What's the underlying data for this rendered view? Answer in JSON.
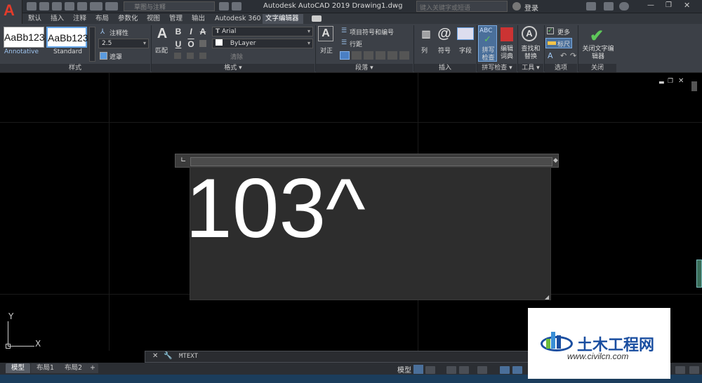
{
  "titlebar": {
    "logo": "A",
    "workspace_placeholder": "草图与注释",
    "title": "Autodesk AutoCAD 2019    Drawing1.dwg",
    "search_placeholder": "键入关键字或短语",
    "login_label": "登录"
  },
  "ribbon_tabs": [
    "默认",
    "插入",
    "注释",
    "布局",
    "参数化",
    "视图",
    "管理",
    "输出",
    "Autodesk 360",
    "文字编辑器"
  ],
  "active_tab": "文字编辑器",
  "style_panel": {
    "style_a": "AaBb123",
    "style_a_name": "Annotative",
    "style_b": "AaBb123",
    "style_b_name": "Standard",
    "annotative_label": "注释性",
    "text_height": "2.5",
    "mask_label": "遮罩",
    "label": "样式"
  },
  "format_panel": {
    "match_label": "匹配",
    "bold": "B",
    "italic": "I",
    "underline": "U",
    "overline": "O",
    "strike": "A",
    "font": "Arial",
    "color": "ByLayer",
    "clear_label": "清除",
    "label": "格式 ▾"
  },
  "paragraph_panel": {
    "justify_label": "对正",
    "bullets_label": "项目符号和编号",
    "line_spacing_label": "行距",
    "label": "段落 ▾"
  },
  "insert_panel": {
    "columns_label": "列",
    "symbol_label": "符号",
    "field_label": "字段",
    "label": "插入"
  },
  "spell_panel": {
    "spell_icon": "ABC",
    "spell_label": "拼写检查",
    "dict_label": "编辑词典",
    "label": "拼写检查 ▾"
  },
  "tools_panel": {
    "find_label": "查找和替换",
    "label": "工具 ▾"
  },
  "options_panel": {
    "more_label": "更多",
    "ruler_label": "标尺",
    "label": "选项"
  },
  "close_panel": {
    "close_label": "关闭文字编辑器",
    "label": "关闭"
  },
  "editor": {
    "text": "103^"
  },
  "ucs": {
    "x_label": "X",
    "y_label": "Y"
  },
  "command_line": {
    "text": "MTEXT"
  },
  "layout_tabs": [
    "模型",
    "布局1",
    "布局2",
    "+"
  ],
  "status_model": "模型",
  "watermark": {
    "title": "土木工程网",
    "url": "www.civilcn.com"
  },
  "colors": {
    "accent": "#64a5e8",
    "logo_red": "#e23b2b",
    "check_green": "#5ec75a",
    "watermark_blue": "#1a4ea0"
  }
}
